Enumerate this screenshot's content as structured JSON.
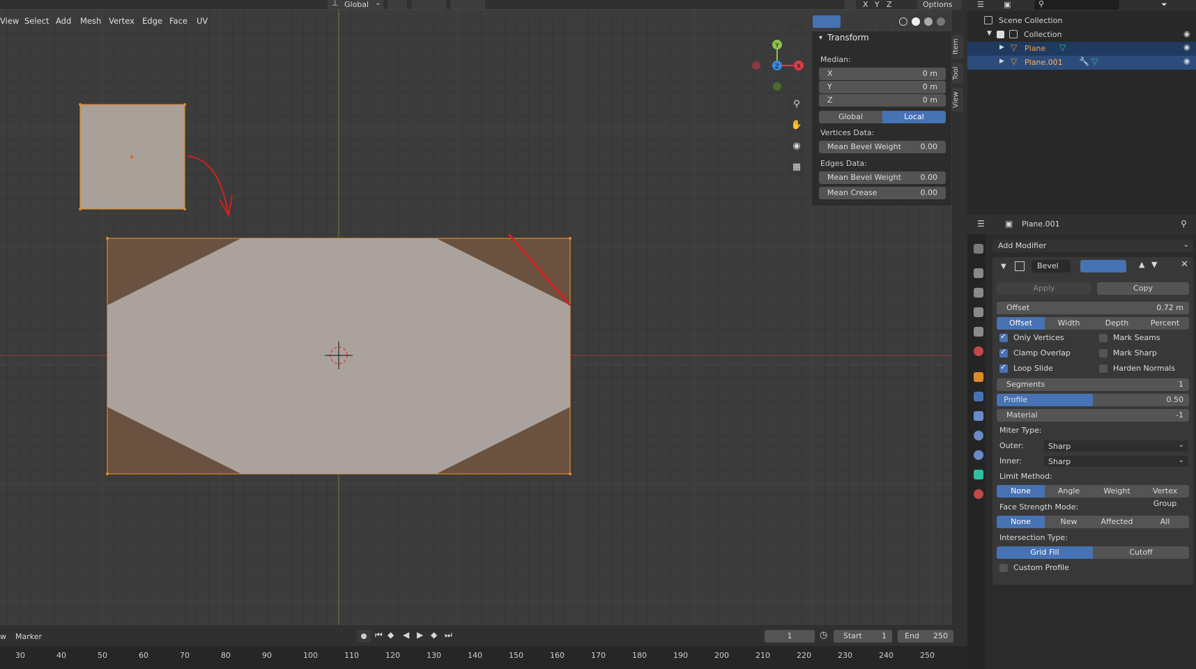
{
  "header": {
    "menu": [
      "View",
      "Select",
      "Add",
      "Mesh",
      "Vertex",
      "Edge",
      "Face",
      "UV"
    ],
    "orientation": "Global",
    "xyz": [
      "X",
      "Y",
      "Z"
    ],
    "options": "Options"
  },
  "transform_panel": {
    "title": "Transform",
    "median_label": "Median:",
    "fields": [
      {
        "label": "X",
        "value": "0 m"
      },
      {
        "label": "Y",
        "value": "0 m"
      },
      {
        "label": "Z",
        "value": "0 m"
      }
    ],
    "space": [
      "Global",
      "Local"
    ],
    "space_active": "Local",
    "vertices_data_label": "Vertices Data:",
    "vertices_bevel": {
      "label": "Mean Bevel Weight",
      "value": "0.00"
    },
    "edges_data_label": "Edges Data:",
    "edges_bevel": {
      "label": "Mean Bevel Weight",
      "value": "0.00"
    },
    "edges_crease": {
      "label": "Mean Crease",
      "value": "0.00"
    }
  },
  "sidebar_tabs": [
    "Item",
    "Tool",
    "View"
  ],
  "gizmo_axes": {
    "y": "Y",
    "z": "Z",
    "x": "X"
  },
  "outliner": {
    "scene_collection": "Scene Collection",
    "collection": "Collection",
    "items": [
      "Plane",
      "Plane.001"
    ]
  },
  "properties": {
    "object_name": "Plane.001",
    "add_modifier": "Add Modifier",
    "modifier_name": "Bevel",
    "apply": "Apply",
    "copy": "Copy",
    "offset": {
      "label": "Offset",
      "value": "0.72 m"
    },
    "width_types": [
      "Offset",
      "Width",
      "Depth",
      "Percent"
    ],
    "checks_left": [
      {
        "label": "Only Vertices",
        "checked": true
      },
      {
        "label": "Clamp Overlap",
        "checked": true
      },
      {
        "label": "Loop Slide",
        "checked": true
      }
    ],
    "checks_right": [
      {
        "label": "Mark Seams",
        "checked": false
      },
      {
        "label": "Mark Sharp",
        "checked": false
      },
      {
        "label": "Harden Normals",
        "checked": false
      }
    ],
    "segments": {
      "label": "Segments",
      "value": "1"
    },
    "profile": {
      "label": "Profile",
      "value": "0.50",
      "fraction": 0.5
    },
    "material": {
      "label": "Material",
      "value": "-1"
    },
    "miter_type_label": "Miter Type:",
    "outer": {
      "label": "Outer:",
      "value": "Sharp"
    },
    "inner": {
      "label": "Inner:",
      "value": "Sharp"
    },
    "limit_method_label": "Limit Method:",
    "limit_methods": [
      "None",
      "Angle",
      "Weight",
      "Vertex Group"
    ],
    "face_strength_label": "Face Strength Mode:",
    "face_strength": [
      "None",
      "New",
      "Affected",
      "All"
    ],
    "intersection_label": "Intersection Type:",
    "intersection": [
      "Grid Fill",
      "Cutoff"
    ],
    "custom_profile": "Custom Profile"
  },
  "timeline": {
    "view": "w",
    "marker": "Marker",
    "current_frame": "1",
    "start_label": "Start",
    "start": "1",
    "end_label": "End",
    "end": "250",
    "ruler": [
      "30",
      "40",
      "50",
      "60",
      "70",
      "80",
      "90",
      "100",
      "110",
      "120",
      "130",
      "140",
      "150",
      "160",
      "170",
      "180",
      "190",
      "200",
      "210",
      "220",
      "230",
      "240",
      "250"
    ]
  },
  "colors": {
    "accent": "#4772b3",
    "mesh_face": "#a9a09a",
    "selected_face": "#6b5140",
    "edge_select": "#e08a2a",
    "annotation": "#d42020"
  }
}
